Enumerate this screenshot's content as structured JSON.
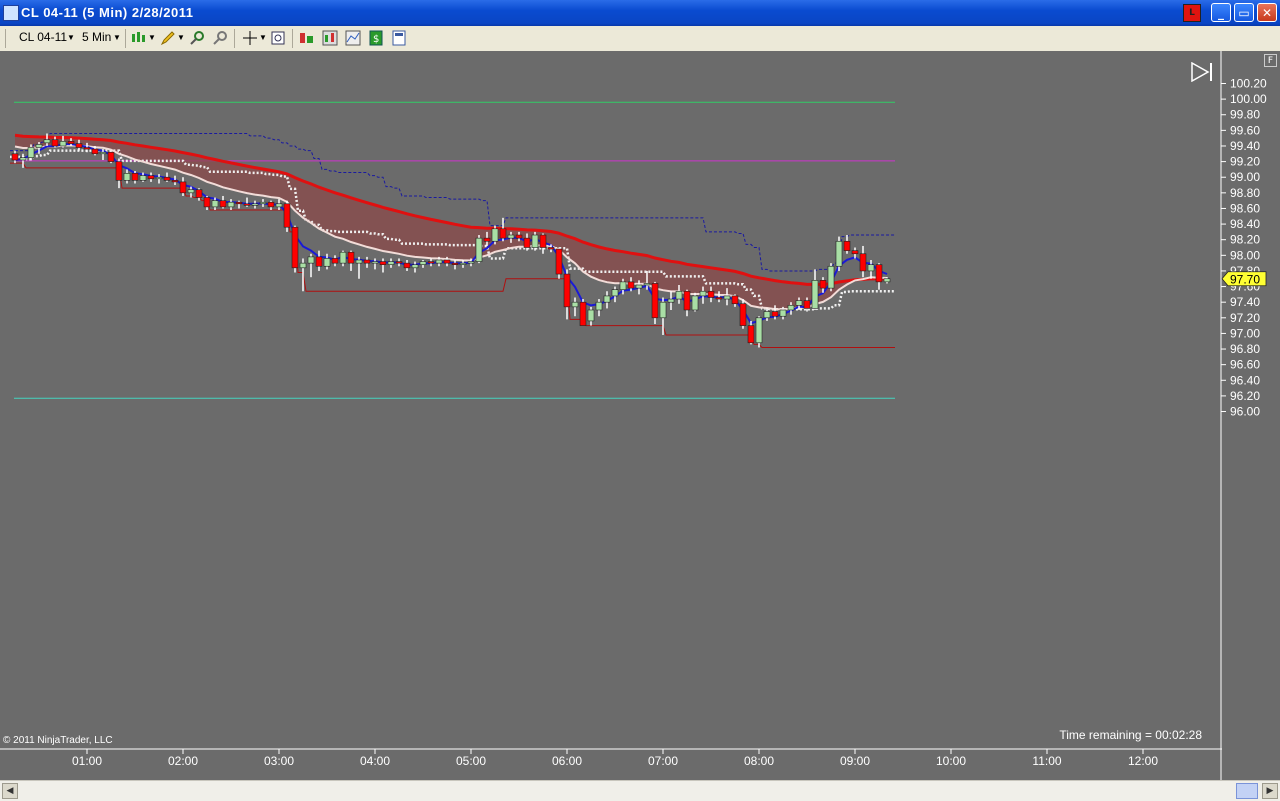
{
  "window": {
    "title": "CL 04-11 (5 Min)  2/28/2011",
    "l_button": "L",
    "minimize": "_",
    "maximize": "▭",
    "close": "✕"
  },
  "toolbar": {
    "instrument": "CL 04-11",
    "interval": "5 Min"
  },
  "chart": {
    "price_box_label": "F",
    "current_price": "97.70",
    "time_remaining": "Time remaining = 00:02:28",
    "copyright": "© 2011 NinjaTrader, LLC",
    "colors": {
      "background": "#6b6b6b",
      "up_candle": "#a9dfa5",
      "down_candle": "#ff0000",
      "ema_slow": "#e01010",
      "ema_fast": "#f2dcd8",
      "ema_fastest": "#1a1ad8",
      "fill": "#8b4a4a"
    }
  },
  "chart_data": {
    "type": "candlestick",
    "y_ticks": [
      "100.20",
      "100.00",
      "99.80",
      "99.60",
      "99.40",
      "99.20",
      "99.00",
      "98.80",
      "98.60",
      "98.40",
      "98.20",
      "98.00",
      "97.80",
      "97.60",
      "97.40",
      "97.20",
      "97.00",
      "96.80",
      "96.60",
      "96.40",
      "96.20",
      "96.00"
    ],
    "ylim": [
      96.0,
      100.2
    ],
    "x_ticks": [
      "01:00",
      "02:00",
      "03:00",
      "04:00",
      "05:00",
      "06:00",
      "07:00",
      "08:00",
      "09:00",
      "10:00",
      "11:00",
      "12:00"
    ],
    "x_range": [
      "00:15",
      "12:30"
    ],
    "levels": [
      {
        "name": "upper-green",
        "value": 99.96,
        "color": "#33cc66"
      },
      {
        "name": "lower-cyan",
        "value": 96.17,
        "color": "#44d4c0"
      },
      {
        "name": "magenta",
        "value": 99.21,
        "color": "#cc33cc"
      }
    ],
    "candles": [
      {
        "t": "00:15",
        "o": 99.3,
        "h": 99.34,
        "l": 99.18,
        "c": 99.22
      },
      {
        "t": "00:20",
        "o": 99.22,
        "h": 99.3,
        "l": 99.12,
        "c": 99.25
      },
      {
        "t": "00:25",
        "o": 99.25,
        "h": 99.42,
        "l": 99.22,
        "c": 99.38
      },
      {
        "t": "00:30",
        "o": 99.38,
        "h": 99.45,
        "l": 99.3,
        "c": 99.42
      },
      {
        "t": "00:35",
        "o": 99.44,
        "h": 99.56,
        "l": 99.4,
        "c": 99.48
      },
      {
        "t": "00:40",
        "o": 99.48,
        "h": 99.52,
        "l": 99.38,
        "c": 99.4
      },
      {
        "t": "00:45",
        "o": 99.4,
        "h": 99.53,
        "l": 99.38,
        "c": 99.46
      },
      {
        "t": "00:50",
        "o": 99.46,
        "h": 99.5,
        "l": 99.4,
        "c": 99.43
      },
      {
        "t": "00:55",
        "o": 99.43,
        "h": 99.48,
        "l": 99.34,
        "c": 99.38
      },
      {
        "t": "01:00",
        "o": 99.38,
        "h": 99.44,
        "l": 99.32,
        "c": 99.36
      },
      {
        "t": "01:05",
        "o": 99.36,
        "h": 99.4,
        "l": 99.28,
        "c": 99.3
      },
      {
        "t": "01:10",
        "o": 99.3,
        "h": 99.36,
        "l": 99.22,
        "c": 99.32
      },
      {
        "t": "01:15",
        "o": 99.32,
        "h": 99.34,
        "l": 99.18,
        "c": 99.2
      },
      {
        "t": "01:20",
        "o": 99.2,
        "h": 99.24,
        "l": 98.86,
        "c": 98.96
      },
      {
        "t": "01:25",
        "o": 98.96,
        "h": 99.1,
        "l": 98.92,
        "c": 99.05
      },
      {
        "t": "01:30",
        "o": 99.05,
        "h": 99.08,
        "l": 98.92,
        "c": 98.96
      },
      {
        "t": "01:35",
        "o": 98.96,
        "h": 99.06,
        "l": 98.94,
        "c": 99.02
      },
      {
        "t": "01:40",
        "o": 99.02,
        "h": 99.06,
        "l": 98.94,
        "c": 98.98
      },
      {
        "t": "01:45",
        "o": 98.98,
        "h": 99.04,
        "l": 98.92,
        "c": 99.0
      },
      {
        "t": "01:50",
        "o": 99.0,
        "h": 99.06,
        "l": 98.94,
        "c": 98.96
      },
      {
        "t": "01:55",
        "o": 98.96,
        "h": 99.02,
        "l": 98.9,
        "c": 98.94
      },
      {
        "t": "02:00",
        "o": 98.94,
        "h": 99.0,
        "l": 98.76,
        "c": 98.8
      },
      {
        "t": "02:05",
        "o": 98.8,
        "h": 98.88,
        "l": 98.74,
        "c": 98.84
      },
      {
        "t": "02:10",
        "o": 98.84,
        "h": 98.86,
        "l": 98.7,
        "c": 98.74
      },
      {
        "t": "02:15",
        "o": 98.74,
        "h": 98.76,
        "l": 98.58,
        "c": 98.62
      },
      {
        "t": "02:20",
        "o": 98.62,
        "h": 98.74,
        "l": 98.58,
        "c": 98.7
      },
      {
        "t": "02:25",
        "o": 98.7,
        "h": 98.76,
        "l": 98.6,
        "c": 98.62
      },
      {
        "t": "02:30",
        "o": 98.62,
        "h": 98.72,
        "l": 98.58,
        "c": 98.68
      },
      {
        "t": "02:35",
        "o": 98.68,
        "h": 98.7,
        "l": 98.6,
        "c": 98.66
      },
      {
        "t": "02:40",
        "o": 98.66,
        "h": 98.74,
        "l": 98.62,
        "c": 98.64
      },
      {
        "t": "02:45",
        "o": 98.64,
        "h": 98.7,
        "l": 98.6,
        "c": 98.66
      },
      {
        "t": "02:50",
        "o": 98.66,
        "h": 98.72,
        "l": 98.62,
        "c": 98.68
      },
      {
        "t": "02:55",
        "o": 98.68,
        "h": 98.7,
        "l": 98.58,
        "c": 98.62
      },
      {
        "t": "03:00",
        "o": 98.62,
        "h": 98.72,
        "l": 98.58,
        "c": 98.66
      },
      {
        "t": "03:05",
        "o": 98.66,
        "h": 98.7,
        "l": 98.3,
        "c": 98.36
      },
      {
        "t": "03:10",
        "o": 98.36,
        "h": 98.38,
        "l": 97.78,
        "c": 97.84
      },
      {
        "t": "03:15",
        "o": 97.84,
        "h": 97.96,
        "l": 97.54,
        "c": 97.9
      },
      {
        "t": "03:20",
        "o": 97.9,
        "h": 98.02,
        "l": 97.72,
        "c": 97.98
      },
      {
        "t": "03:25",
        "o": 97.98,
        "h": 98.06,
        "l": 97.8,
        "c": 97.86
      },
      {
        "t": "03:30",
        "o": 97.86,
        "h": 98.02,
        "l": 97.82,
        "c": 97.96
      },
      {
        "t": "03:35",
        "o": 97.96,
        "h": 98.0,
        "l": 97.86,
        "c": 97.9
      },
      {
        "t": "03:40",
        "o": 97.9,
        "h": 98.06,
        "l": 97.86,
        "c": 98.04
      },
      {
        "t": "03:45",
        "o": 98.04,
        "h": 98.06,
        "l": 97.8,
        "c": 97.9
      },
      {
        "t": "03:50",
        "o": 97.9,
        "h": 97.98,
        "l": 97.7,
        "c": 97.94
      },
      {
        "t": "03:55",
        "o": 97.94,
        "h": 97.98,
        "l": 97.84,
        "c": 97.9
      },
      {
        "t": "04:00",
        "o": 97.9,
        "h": 97.96,
        "l": 97.82,
        "c": 97.92
      },
      {
        "t": "04:05",
        "o": 97.92,
        "h": 97.96,
        "l": 97.78,
        "c": 97.88
      },
      {
        "t": "04:10",
        "o": 97.88,
        "h": 97.96,
        "l": 97.84,
        "c": 97.92
      },
      {
        "t": "04:15",
        "o": 97.92,
        "h": 97.96,
        "l": 97.86,
        "c": 97.9
      },
      {
        "t": "04:20",
        "o": 97.9,
        "h": 97.94,
        "l": 97.8,
        "c": 97.84
      },
      {
        "t": "04:25",
        "o": 97.84,
        "h": 97.92,
        "l": 97.78,
        "c": 97.88
      },
      {
        "t": "04:30",
        "o": 97.88,
        "h": 97.94,
        "l": 97.84,
        "c": 97.92
      },
      {
        "t": "04:35",
        "o": 97.92,
        "h": 97.96,
        "l": 97.86,
        "c": 97.9
      },
      {
        "t": "04:40",
        "o": 97.9,
        "h": 97.98,
        "l": 97.86,
        "c": 97.94
      },
      {
        "t": "04:45",
        "o": 97.94,
        "h": 97.98,
        "l": 97.86,
        "c": 97.9
      },
      {
        "t": "04:50",
        "o": 97.9,
        "h": 97.94,
        "l": 97.82,
        "c": 97.88
      },
      {
        "t": "04:55",
        "o": 97.88,
        "h": 97.94,
        "l": 97.84,
        "c": 97.9
      },
      {
        "t": "05:00",
        "o": 97.9,
        "h": 97.96,
        "l": 97.86,
        "c": 97.92
      },
      {
        "t": "05:05",
        "o": 97.92,
        "h": 98.26,
        "l": 97.9,
        "c": 98.22
      },
      {
        "t": "05:10",
        "o": 98.22,
        "h": 98.3,
        "l": 98.12,
        "c": 98.18
      },
      {
        "t": "05:15",
        "o": 98.18,
        "h": 98.38,
        "l": 98.14,
        "c": 98.34
      },
      {
        "t": "05:20",
        "o": 98.34,
        "h": 98.48,
        "l": 98.18,
        "c": 98.22
      },
      {
        "t": "05:25",
        "o": 98.22,
        "h": 98.3,
        "l": 98.16,
        "c": 98.26
      },
      {
        "t": "05:30",
        "o": 98.26,
        "h": 98.3,
        "l": 98.18,
        "c": 98.22
      },
      {
        "t": "05:35",
        "o": 98.22,
        "h": 98.28,
        "l": 98.06,
        "c": 98.1
      },
      {
        "t": "05:40",
        "o": 98.1,
        "h": 98.3,
        "l": 98.06,
        "c": 98.26
      },
      {
        "t": "05:45",
        "o": 98.26,
        "h": 98.28,
        "l": 98.02,
        "c": 98.1
      },
      {
        "t": "05:50",
        "o": 98.1,
        "h": 98.14,
        "l": 98.04,
        "c": 98.08
      },
      {
        "t": "05:55",
        "o": 98.08,
        "h": 98.1,
        "l": 97.7,
        "c": 97.76
      },
      {
        "t": "06:00",
        "o": 97.76,
        "h": 97.82,
        "l": 97.18,
        "c": 97.34
      },
      {
        "t": "06:05",
        "o": 97.34,
        "h": 97.46,
        "l": 97.22,
        "c": 97.4
      },
      {
        "t": "06:10",
        "o": 97.4,
        "h": 97.44,
        "l": 97.1,
        "c": 97.1
      },
      {
        "t": "06:15",
        "o": 97.16,
        "h": 97.34,
        "l": 97.1,
        "c": 97.3
      },
      {
        "t": "06:20",
        "o": 97.3,
        "h": 97.44,
        "l": 97.22,
        "c": 97.4
      },
      {
        "t": "06:25",
        "o": 97.4,
        "h": 97.54,
        "l": 97.32,
        "c": 97.48
      },
      {
        "t": "06:30",
        "o": 97.48,
        "h": 97.6,
        "l": 97.4,
        "c": 97.56
      },
      {
        "t": "06:35",
        "o": 97.56,
        "h": 97.7,
        "l": 97.5,
        "c": 97.66
      },
      {
        "t": "06:40",
        "o": 97.66,
        "h": 97.72,
        "l": 97.54,
        "c": 97.58
      },
      {
        "t": "06:45",
        "o": 97.58,
        "h": 97.68,
        "l": 97.5,
        "c": 97.62
      },
      {
        "t": "06:50",
        "o": 97.62,
        "h": 97.8,
        "l": 97.56,
        "c": 97.64
      },
      {
        "t": "06:55",
        "o": 97.64,
        "h": 97.66,
        "l": 97.12,
        "c": 97.2
      },
      {
        "t": "07:00",
        "o": 97.2,
        "h": 97.46,
        "l": 96.98,
        "c": 97.4
      },
      {
        "t": "07:05",
        "o": 97.4,
        "h": 97.54,
        "l": 97.3,
        "c": 97.44
      },
      {
        "t": "07:10",
        "o": 97.44,
        "h": 97.62,
        "l": 97.38,
        "c": 97.54
      },
      {
        "t": "07:15",
        "o": 97.54,
        "h": 97.56,
        "l": 97.22,
        "c": 97.3
      },
      {
        "t": "07:20",
        "o": 97.3,
        "h": 97.52,
        "l": 97.28,
        "c": 97.48
      },
      {
        "t": "07:25",
        "o": 97.48,
        "h": 97.6,
        "l": 97.38,
        "c": 97.54
      },
      {
        "t": "07:30",
        "o": 97.54,
        "h": 97.6,
        "l": 97.4,
        "c": 97.46
      },
      {
        "t": "07:35",
        "o": 97.46,
        "h": 97.54,
        "l": 97.4,
        "c": 97.44
      },
      {
        "t": "07:40",
        "o": 97.44,
        "h": 97.58,
        "l": 97.36,
        "c": 97.48
      },
      {
        "t": "07:45",
        "o": 97.48,
        "h": 97.5,
        "l": 97.34,
        "c": 97.38
      },
      {
        "t": "07:50",
        "o": 97.38,
        "h": 97.44,
        "l": 97.06,
        "c": 97.1
      },
      {
        "t": "07:55",
        "o": 97.1,
        "h": 97.16,
        "l": 96.86,
        "c": 96.88
      },
      {
        "t": "08:00",
        "o": 96.88,
        "h": 97.22,
        "l": 96.82,
        "c": 97.2
      },
      {
        "t": "08:05",
        "o": 97.2,
        "h": 97.32,
        "l": 97.16,
        "c": 97.28
      },
      {
        "t": "08:10",
        "o": 97.28,
        "h": 97.36,
        "l": 97.18,
        "c": 97.22
      },
      {
        "t": "08:15",
        "o": 97.22,
        "h": 97.34,
        "l": 97.18,
        "c": 97.3
      },
      {
        "t": "08:20",
        "o": 97.3,
        "h": 97.4,
        "l": 97.24,
        "c": 97.36
      },
      {
        "t": "08:25",
        "o": 97.36,
        "h": 97.46,
        "l": 97.3,
        "c": 97.42
      },
      {
        "t": "08:30",
        "o": 97.42,
        "h": 97.46,
        "l": 97.28,
        "c": 97.32
      },
      {
        "t": "08:35",
        "o": 97.32,
        "h": 97.82,
        "l": 97.3,
        "c": 97.68
      },
      {
        "t": "08:40",
        "o": 97.68,
        "h": 97.72,
        "l": 97.52,
        "c": 97.58
      },
      {
        "t": "08:45",
        "o": 97.58,
        "h": 97.9,
        "l": 97.54,
        "c": 97.86
      },
      {
        "t": "08:50",
        "o": 97.86,
        "h": 98.24,
        "l": 97.8,
        "c": 98.18
      },
      {
        "t": "08:55",
        "o": 98.18,
        "h": 98.26,
        "l": 98.02,
        "c": 98.06
      },
      {
        "t": "09:00",
        "o": 98.06,
        "h": 98.1,
        "l": 97.96,
        "c": 98.02
      },
      {
        "t": "09:05",
        "o": 98.02,
        "h": 98.12,
        "l": 97.72,
        "c": 97.8
      },
      {
        "t": "09:10",
        "o": 97.8,
        "h": 97.94,
        "l": 97.7,
        "c": 97.88
      },
      {
        "t": "09:15",
        "o": 97.88,
        "h": 97.9,
        "l": 97.56,
        "c": 97.66
      },
      {
        "t": "09:20",
        "o": 97.66,
        "h": 97.72,
        "l": 97.64,
        "c": 97.7
      }
    ]
  }
}
